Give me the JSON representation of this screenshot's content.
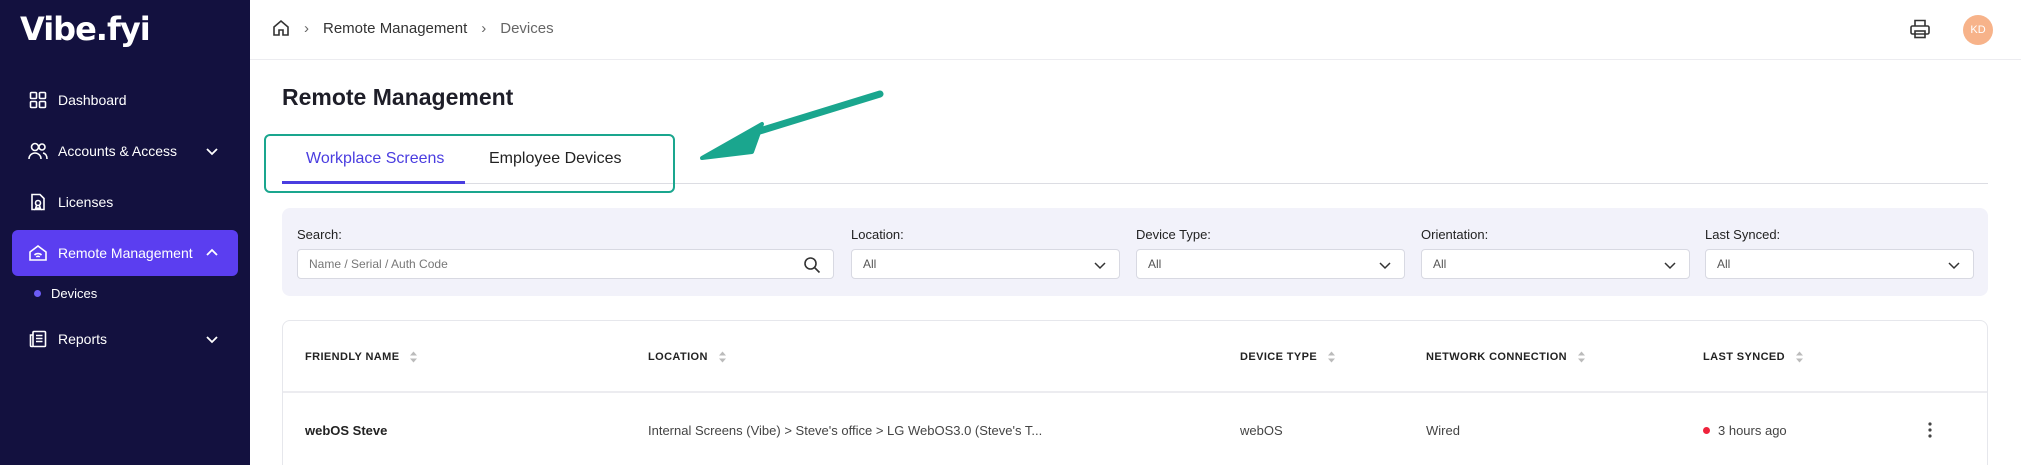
{
  "app": {
    "logo": "Vibe.fyi"
  },
  "sidebar": {
    "items": [
      {
        "label": "Dashboard",
        "icon": "grid-icon"
      },
      {
        "label": "Accounts & Access",
        "icon": "users-icon"
      },
      {
        "label": "Licenses",
        "icon": "license-icon"
      },
      {
        "label": "Remote Management",
        "icon": "remote-icon"
      },
      {
        "label": "Reports",
        "icon": "reports-icon"
      }
    ],
    "sub_items": [
      {
        "label": "Devices"
      }
    ]
  },
  "breadcrumb": {
    "items": [
      "Remote Management",
      "Devices"
    ]
  },
  "user": {
    "initials": "KD",
    "avatar_color": "#f7b38a"
  },
  "page": {
    "title": "Remote Management"
  },
  "tabs": [
    {
      "label": "Workplace Screens",
      "active": true
    },
    {
      "label": "Employee Devices",
      "active": false
    }
  ],
  "filters": {
    "search": {
      "label": "Search:",
      "placeholder": "Name / Serial / Auth Code"
    },
    "location": {
      "label": "Location:",
      "value": "All"
    },
    "device_type": {
      "label": "Device Type:",
      "value": "All"
    },
    "orientation": {
      "label": "Orientation:",
      "value": "All"
    },
    "last_synced": {
      "label": "Last Synced:",
      "value": "All"
    }
  },
  "table": {
    "columns": [
      "FRIENDLY NAME",
      "LOCATION",
      "DEVICE TYPE",
      "NETWORK CONNECTION",
      "LAST SYNCED"
    ],
    "rows": [
      {
        "name": "webOS Steve",
        "location": "Internal Screens (Vibe) > Steve's office > LG WebOS3.0 (Steve's T...",
        "device_type": "webOS",
        "network": "Wired",
        "last_synced": "3 hours ago"
      }
    ]
  },
  "colors": {
    "sidebar_bg": "#13113f",
    "active_nav": "#5b3ef0",
    "accent": "#4a3de0",
    "highlight": "#1aa68e",
    "status_offline": "#ef233c"
  }
}
